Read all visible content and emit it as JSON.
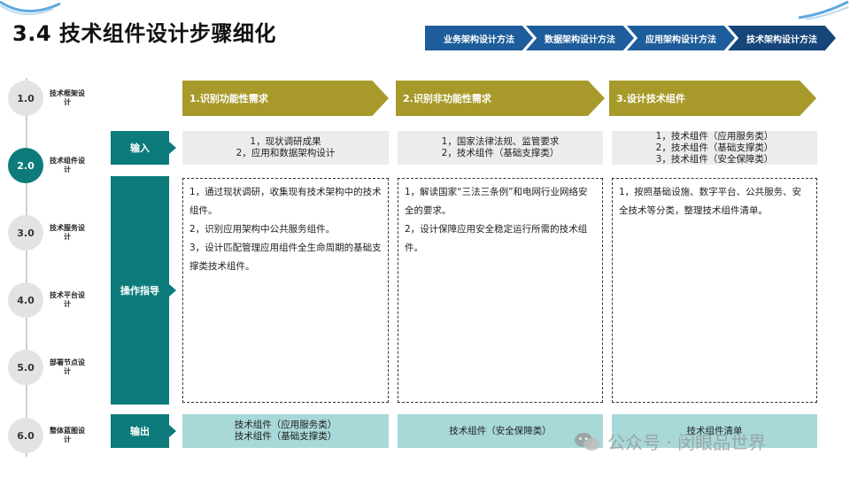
{
  "page": {
    "title": "3.4 技术组件设计步骤细化"
  },
  "methods": [
    {
      "label": "业务架构设计方法"
    },
    {
      "label": "数据架构设计方法"
    },
    {
      "label": "应用架构设计方法"
    },
    {
      "label": "技术架构设计方法"
    }
  ],
  "steps": [
    {
      "num": "1.0",
      "label": "技术框架设计"
    },
    {
      "num": "2.0",
      "label": "技术组件设计"
    },
    {
      "num": "3.0",
      "label": "技术服务设计"
    },
    {
      "num": "4.0",
      "label": "技术平台设计"
    },
    {
      "num": "5.0",
      "label": "部署节点设计"
    },
    {
      "num": "6.0",
      "label": "整体蓝图设计"
    }
  ],
  "phases": [
    {
      "label": "1.识别功能性需求"
    },
    {
      "label": "2.识别非功能性需求"
    },
    {
      "label": "3.设计技术组件"
    }
  ],
  "rows": {
    "input_label": "输入",
    "guide_label": "操作指导",
    "output_label": "输出"
  },
  "inputs": [
    [
      "1，现状调研成果",
      "2，应用和数据架构设计"
    ],
    [
      "1，国家法律法规、监管要求",
      "2，技术组件（基础支撑类）"
    ],
    [
      "1，技术组件（应用服务类）",
      "2，技术组件（基础支撑类）",
      "3，技术组件（安全保障类）"
    ]
  ],
  "guides": [
    [
      "1，通过现状调研，收集现有技术架构中的技术组件。",
      "2，识别应用架构中公共服务组件。",
      "3，设计匹配管理应用组件全生命周期的基础支撑类技术组件。"
    ],
    [
      "1，解读国家“三法三条例”和电网行业网络安全的要求。",
      "2，设计保障应用安全稳定运行所需的技术组件。"
    ],
    [
      "1，按照基础设施、数字平台、公共服务、安全技术等分类，整理技术组件清单。"
    ]
  ],
  "outputs": [
    [
      "技术组件（应用服务类）",
      "技术组件（基础支撑类）"
    ],
    [
      "技术组件（安全保障类）"
    ],
    [
      "技术组件清单"
    ]
  ],
  "watermark": {
    "text": "公众号 · 闵眼品世界",
    "icon": "wechat-icon"
  },
  "colors": {
    "teal": "#0d7b7b",
    "olive": "#a89a2a",
    "method_blue": "#1d5d9b",
    "output_bg": "#a8d8d8",
    "input_bg": "#ececec"
  }
}
